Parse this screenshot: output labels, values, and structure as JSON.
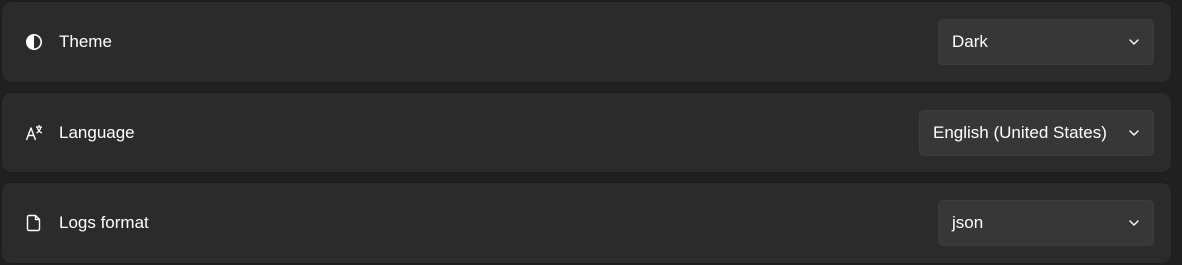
{
  "settings": [
    {
      "label": "Theme",
      "icon": "contrast-icon",
      "value": "Dark"
    },
    {
      "label": "Language",
      "icon": "translate-icon",
      "value": "English (United States)"
    },
    {
      "label": "Logs format",
      "icon": "document-icon",
      "value": "json"
    }
  ]
}
